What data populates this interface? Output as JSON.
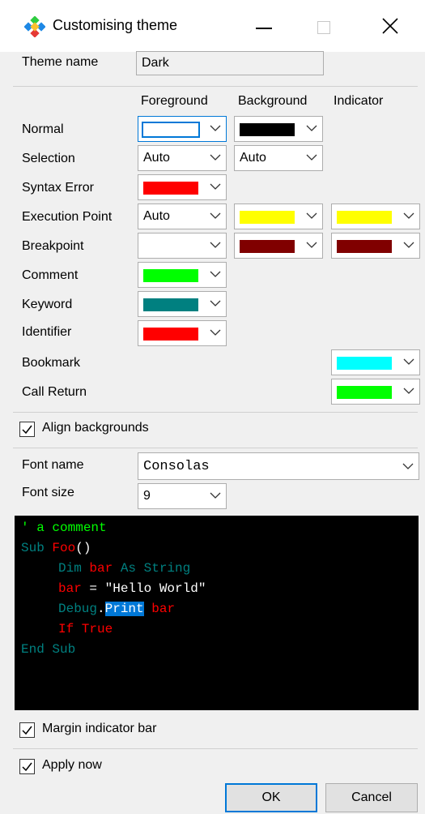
{
  "window": {
    "title": "Customising theme"
  },
  "theme_name": {
    "label": "Theme name",
    "value": "Dark"
  },
  "columns": {
    "foreground": "Foreground",
    "background": "Background",
    "indicator": "Indicator"
  },
  "rows": {
    "normal": {
      "label": "Normal",
      "fg_color": "#ffffff",
      "bg_color": "#000000"
    },
    "selection": {
      "label": "Selection",
      "fg_value": "Auto",
      "bg_value": "Auto"
    },
    "syntax_error": {
      "label": "Syntax Error",
      "fg_color": "#ff0000"
    },
    "execution_point": {
      "label": "Execution Point",
      "fg_value": "Auto",
      "bg_color": "#ffff00",
      "ind_color": "#ffff00"
    },
    "breakpoint": {
      "label": "Breakpoint",
      "fg_color": "#ffffff",
      "bg_color": "#800000",
      "ind_color": "#800000"
    },
    "comment": {
      "label": "Comment",
      "fg_color": "#00ff00"
    },
    "keyword": {
      "label": "Keyword",
      "fg_color": "#008080"
    },
    "identifier": {
      "label": "Identifier",
      "fg_color": "#ff0000"
    },
    "bookmark": {
      "label": "Bookmark",
      "ind_color": "#00ffff"
    },
    "call_return": {
      "label": "Call Return",
      "ind_color": "#00ff00"
    }
  },
  "align_backgrounds": {
    "label": "Align backgrounds",
    "checked": true
  },
  "font_name": {
    "label": "Font name",
    "value": "Consolas"
  },
  "font_size": {
    "label": "Font size",
    "value": "9"
  },
  "preview": {
    "line1": {
      "comment": "' a comment"
    },
    "line2": {
      "kw": "Sub ",
      "ident": "Foo",
      "rest": "()"
    },
    "line3": {
      "kw1": "Dim ",
      "ident": "bar",
      "kw2": " As String"
    },
    "line4": {
      "ident": "bar",
      "rest": " = \"Hello World\""
    },
    "line5": {
      "kw": "Debug",
      "dot": ".",
      "sel": "Print",
      "ident": " bar"
    },
    "line6": {
      "ident": "If True"
    },
    "line7": {
      "kw": "End Sub"
    }
  },
  "margin_indicator_bar": {
    "label": "Margin indicator bar",
    "checked": true
  },
  "apply_now": {
    "label": "Apply now",
    "checked": true
  },
  "buttons": {
    "ok": "OK",
    "cancel": "Cancel"
  },
  "colors": {
    "accent": "#0078d7",
    "code_bg": "#000000",
    "selection_bg": "#0078d7"
  }
}
